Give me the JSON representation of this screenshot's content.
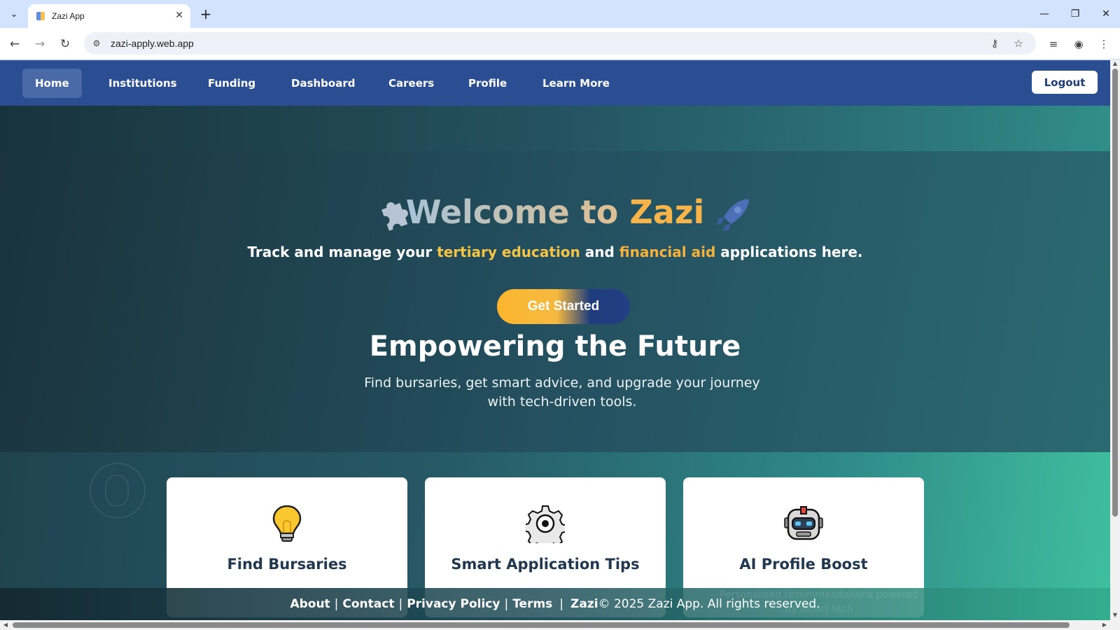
{
  "browser": {
    "tab_title": "Zazi App",
    "url": "zazi-apply.web.app"
  },
  "nav": {
    "items": [
      {
        "label": "Home",
        "active": true
      },
      {
        "label": "Institutions",
        "active": false
      },
      {
        "label": "Funding",
        "active": false
      },
      {
        "label": "Dashboard",
        "active": false
      },
      {
        "label": "Careers",
        "active": false
      },
      {
        "label": "Profile",
        "active": false
      },
      {
        "label": "Learn More",
        "active": false
      }
    ],
    "logout_label": "Logout"
  },
  "hero": {
    "title_prefix": "Welcome to ",
    "title_brand": "Zazi",
    "tagline": {
      "part1": "Track and manage your ",
      "hl1": "tertiary education",
      "part2": " and ",
      "hl2": "financial aid",
      "part3": " applications here."
    },
    "cta_label": "Get Started",
    "section_title": "Empowering the Future",
    "section_desc": "Find bursaries, get smart advice, and upgrade your journey with tech-driven tools."
  },
  "features": [
    {
      "title": "Find Bursaries",
      "icon": "lightbulb-icon"
    },
    {
      "title": "Smart Application Tips",
      "icon": "gear-icon"
    },
    {
      "title": "AI Profile Boost",
      "icon": "robot-icon"
    }
  ],
  "footer": {
    "links": [
      "About",
      "Contact",
      "Privacy Policy",
      "Terms"
    ],
    "brand": "Zazi",
    "copyright": "© 2025 Zazi App. All rights reserved.",
    "ghost_text": "Personalised recommendations powered by smart tech"
  },
  "colors": {
    "nav_bg": "#2b4e92",
    "accent": "#f6b44a",
    "highlight": "#f4c447"
  }
}
